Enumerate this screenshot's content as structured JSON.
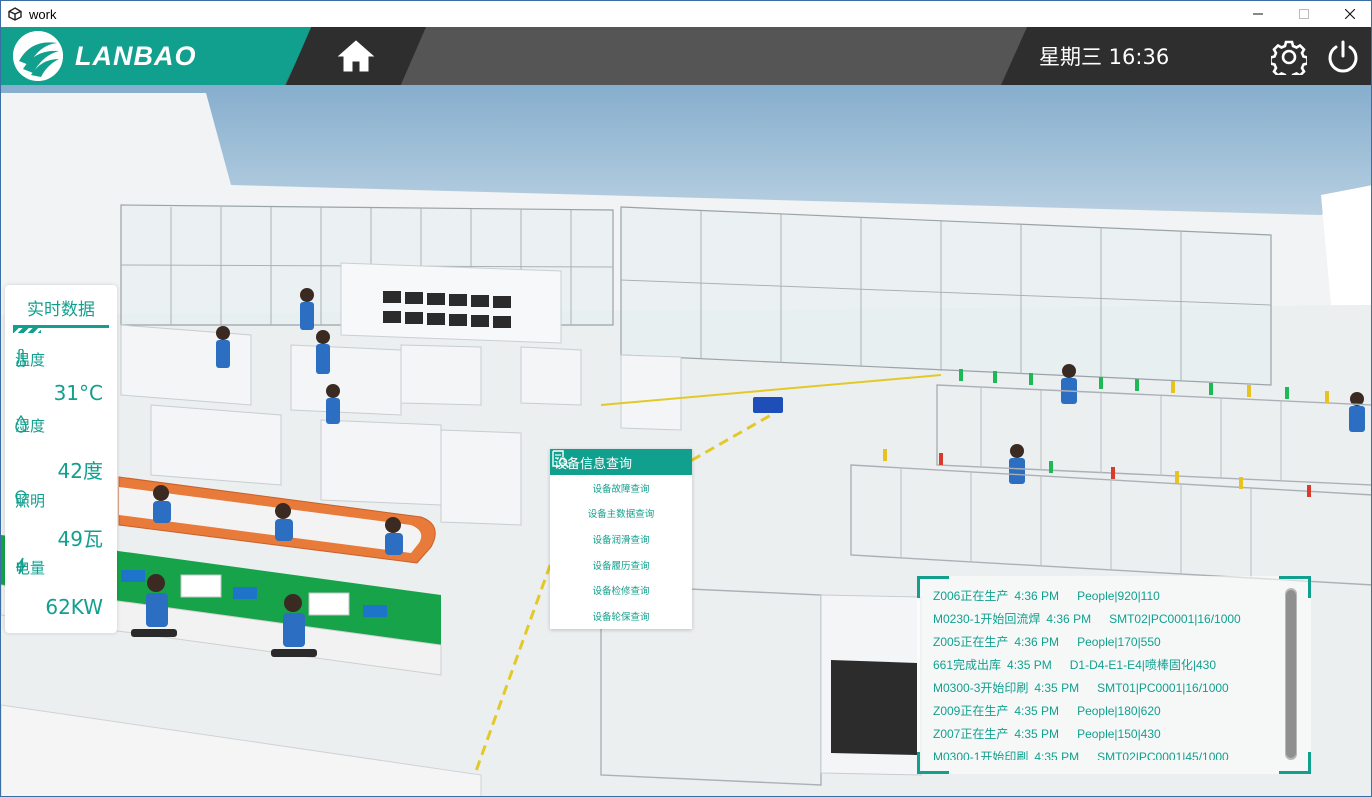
{
  "window": {
    "title": "work"
  },
  "header": {
    "brand": "LANBAO",
    "clock": "星期三 16:36"
  },
  "realtime": {
    "title": "实时数据",
    "items": [
      {
        "label": "温度",
        "value": "31°C",
        "icon": "thermometer-icon"
      },
      {
        "label": "湿度",
        "value": "42度",
        "icon": "droplet-icon"
      },
      {
        "label": "照明",
        "value": "49瓦",
        "icon": "bulb-icon"
      },
      {
        "label": "电量",
        "value": "62KW",
        "icon": "lightning-icon"
      }
    ]
  },
  "device_menu": {
    "title": "设备信息查询",
    "items": [
      "设备故障查询",
      "设备主数据查询",
      "设备润滑查询",
      "设备履历查询",
      "设备检修查询",
      "设备轮保查询"
    ]
  },
  "log": {
    "rows": [
      {
        "event": "Z006正在生产",
        "time": "4:36 PM",
        "detail": "People|920|110"
      },
      {
        "event": "M0230-1开始回流焊",
        "time": "4:36 PM",
        "detail": "SMT02|PC0001|16/1000"
      },
      {
        "event": "Z005正在生产",
        "time": "4:36 PM",
        "detail": "People|170|550"
      },
      {
        "event": "661完成出库",
        "time": "4:35 PM",
        "detail": "D1-D4-E1-E4|喷棒固化|430"
      },
      {
        "event": "M0300-3开始印刷",
        "time": "4:35 PM",
        "detail": "SMT01|PC0001|16/1000"
      },
      {
        "event": "Z009正在生产",
        "time": "4:35 PM",
        "detail": "People|180|620"
      },
      {
        "event": "Z007正在生产",
        "time": "4:35 PM",
        "detail": "People|150|430"
      },
      {
        "event": "M0300-1开始印刷",
        "time": "4:35 PM",
        "detail": "SMT02|PC0001|45/1000"
      }
    ]
  },
  "colors": {
    "accent": "#12a08e",
    "header_dark": "#2e2e2e",
    "header_mid": "#555555"
  }
}
